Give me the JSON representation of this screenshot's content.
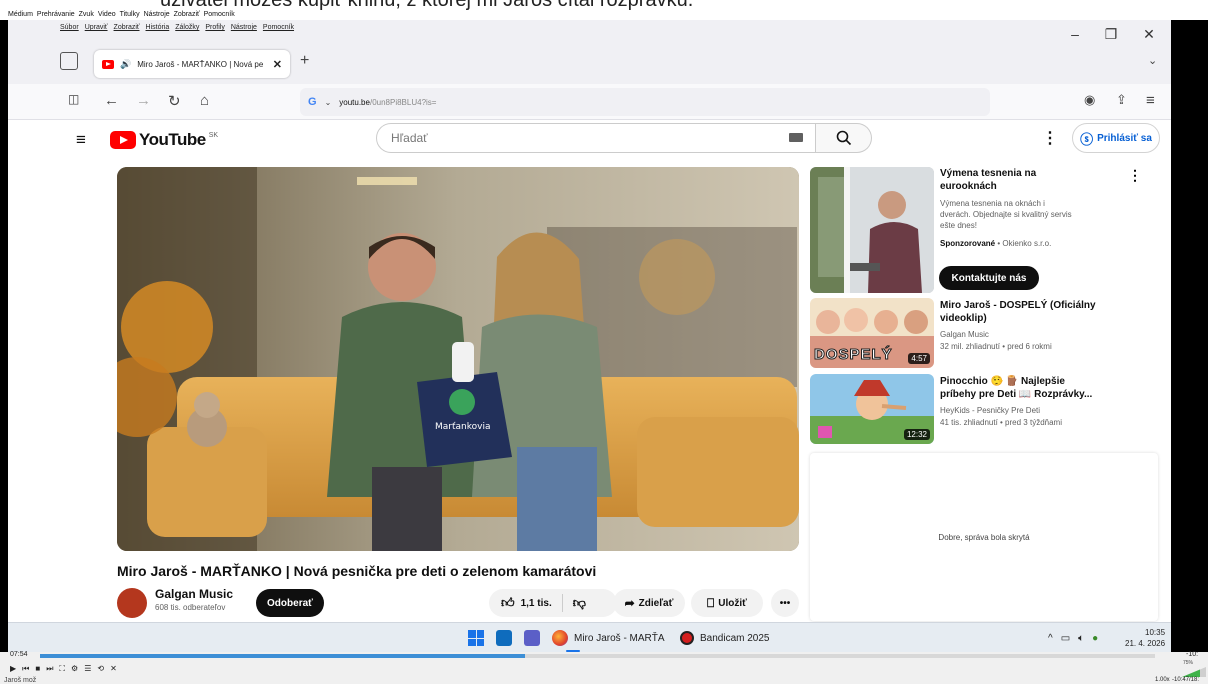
{
  "caption": "uzivatel môžeš kúpiť knihu, z ktorej mi Jaroš čítal rozprávku.",
  "vlc_menu": [
    "Médium",
    "Prehrávanie",
    "Zvuk",
    "Video",
    "Titulky",
    "Nástroje",
    "Zobraziť",
    "Pomocník"
  ],
  "firefox_menu": [
    "Súbor",
    "Upraviť",
    "Zobraziť",
    "História",
    "Záložky",
    "Profily",
    "Nástroje",
    "Pomocník"
  ],
  "tab": {
    "title": "Miro Jaroš - MARŤANKO | Nová pe"
  },
  "url": {
    "host": "youtu.be",
    "path": "/0un8Pi8BLU4?is="
  },
  "youtube": {
    "logo_text": "YouTube",
    "region": "SK",
    "search_placeholder": "Hľadať",
    "signin_label": "Prihlásiť sa",
    "video_title": "Miro Jaroš - MARŤANKO | Nová pesnička pre deti o zelenom kamarátovi",
    "channel_name": "Galgan Music",
    "subscribers": "608 tis. odberateľov",
    "subscribe_label": "Odoberať",
    "likes": "1,1 tis.",
    "share_label": "Zdieľať",
    "save_label": "Uložiť"
  },
  "sidebar": {
    "ad": {
      "title_line1": "Výmena tesnenia na",
      "title_line2": "eurooknách",
      "desc_line1": "Výmena tesnenia na oknách i",
      "desc_line2": "dverách. Objednajte si kvalitný servis",
      "desc_line3": "ešte dnes!",
      "sponsored": "Sponzorované",
      "advertiser": "Okienko s.r.o.",
      "cta": "Kontaktujte nás"
    },
    "videos": [
      {
        "title_line1": "Miro Jaroš - DOSPELÝ (Oficiálny",
        "title_line2": "videoklip)",
        "channel": "Galgan Music",
        "meta": "32 mil. zhliadnutí • pred 6 rokmi",
        "duration": "4:57",
        "thumb_text": "DOSPELÝ"
      },
      {
        "title_line1": "Pinocchio 🤥 🪵 Najlepšie",
        "title_line2": "príbehy pre Deti 📖 Rozprávky...",
        "channel": "HeyKids - Pesničky Pre Deti",
        "meta": "41 tis. zhliadnutí • pred 3 týždňami",
        "duration": "12:32"
      }
    ],
    "hidden_message": "Dobre, správa bola skrytá"
  },
  "taskbar": {
    "firefox_label": "Miro Jaroš - MARŤA",
    "bandicam_label": "Bandicam 2025",
    "time": "10:35",
    "date": "21. 4. 2026"
  },
  "vlc": {
    "elapsed": "07:54",
    "remaining": "-10:",
    "status_left": "Jaroš mož",
    "speed": "1.00x",
    "time_total": "-10:47/18:",
    "volume": "75%",
    "progress_fraction": 0.435
  }
}
